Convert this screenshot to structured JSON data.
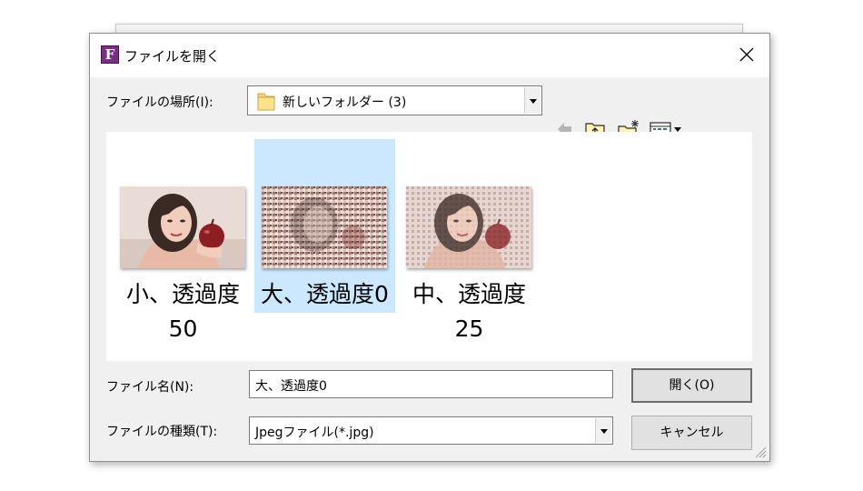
{
  "window": {
    "title": "ファイルを開く",
    "app_icon_letter": "F"
  },
  "location": {
    "label": "ファイルの場所(I):",
    "value": "新しいフォルダー (3)"
  },
  "toolbar": [
    "back-arrow-icon",
    "up-folder-icon",
    "new-folder-icon",
    "view-menu-icon"
  ],
  "files": [
    {
      "name_line1": "小、透過度",
      "name_line2": "50",
      "selected": false
    },
    {
      "name_line1": "大、透過度0",
      "name_line2": "",
      "selected": true
    },
    {
      "name_line1": "中、透過度",
      "name_line2": "25",
      "selected": false
    }
  ],
  "filename": {
    "label": "ファイル名(N):",
    "value": "大、透過度0"
  },
  "filetype": {
    "label": "ファイルの種類(T):",
    "value": "Jpegファイル(*.jpg)"
  },
  "buttons": {
    "open": "開く(O)",
    "cancel": "キャンセル"
  },
  "colors": {
    "selection": "#cce8ff",
    "dialog_bg": "#f0f0f0",
    "app_icon": "#7a2f86"
  }
}
